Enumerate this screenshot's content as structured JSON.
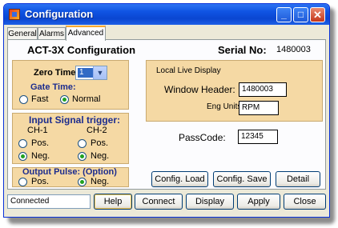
{
  "window": {
    "title": "Configuration",
    "minimize_label": "_",
    "maximize_label": "□",
    "close_label": "✕"
  },
  "tabs": [
    {
      "label": "General"
    },
    {
      "label": "Alarms"
    },
    {
      "label": "Advanced"
    }
  ],
  "device": {
    "name": "ACT-3X Configuration",
    "serial_label": "Serial No:",
    "serial_value": "1480003"
  },
  "zero_time": {
    "label": "Zero Time:",
    "value": "1"
  },
  "gate_time": {
    "label": "Gate Time:",
    "options": [
      {
        "label": "Fast",
        "selected": false
      },
      {
        "label": "Normal",
        "selected": true
      }
    ]
  },
  "input_trigger": {
    "label": "Input Signal trigger:",
    "ch1": {
      "label": "CH-1",
      "pos_label": "Pos.",
      "neg_label": "Neg.",
      "selected": "Neg."
    },
    "ch2": {
      "label": "CH-2",
      "pos_label": "Pos.",
      "neg_label": "Neg.",
      "selected": "Neg."
    }
  },
  "output_pulse": {
    "label": "Output Pulse: (Option)",
    "pos_label": "Pos.",
    "neg_label": "Neg.",
    "selected": "Neg."
  },
  "live_display": {
    "label": "Local Live Display",
    "window_header_label": "Window Header:",
    "window_header_value": "1480003",
    "eng_units_label": "Eng Units",
    "eng_units_value": "RPM"
  },
  "passcode": {
    "label": "PassCode:",
    "value": "12345"
  },
  "panel_buttons": {
    "config_load": "Config. Load",
    "config_save": "Config. Save",
    "detail": "Detail"
  },
  "status": {
    "value": "Connected"
  },
  "footer_buttons": {
    "help": "Help",
    "connect": "Connect",
    "display": "Display",
    "apply": "Apply",
    "close": "Close"
  },
  "colors": {
    "group_fill": "#f5d9a4",
    "titlebar": "#0a46d1",
    "dialog": "#ece9d8",
    "radio_dot": "#21a121"
  }
}
